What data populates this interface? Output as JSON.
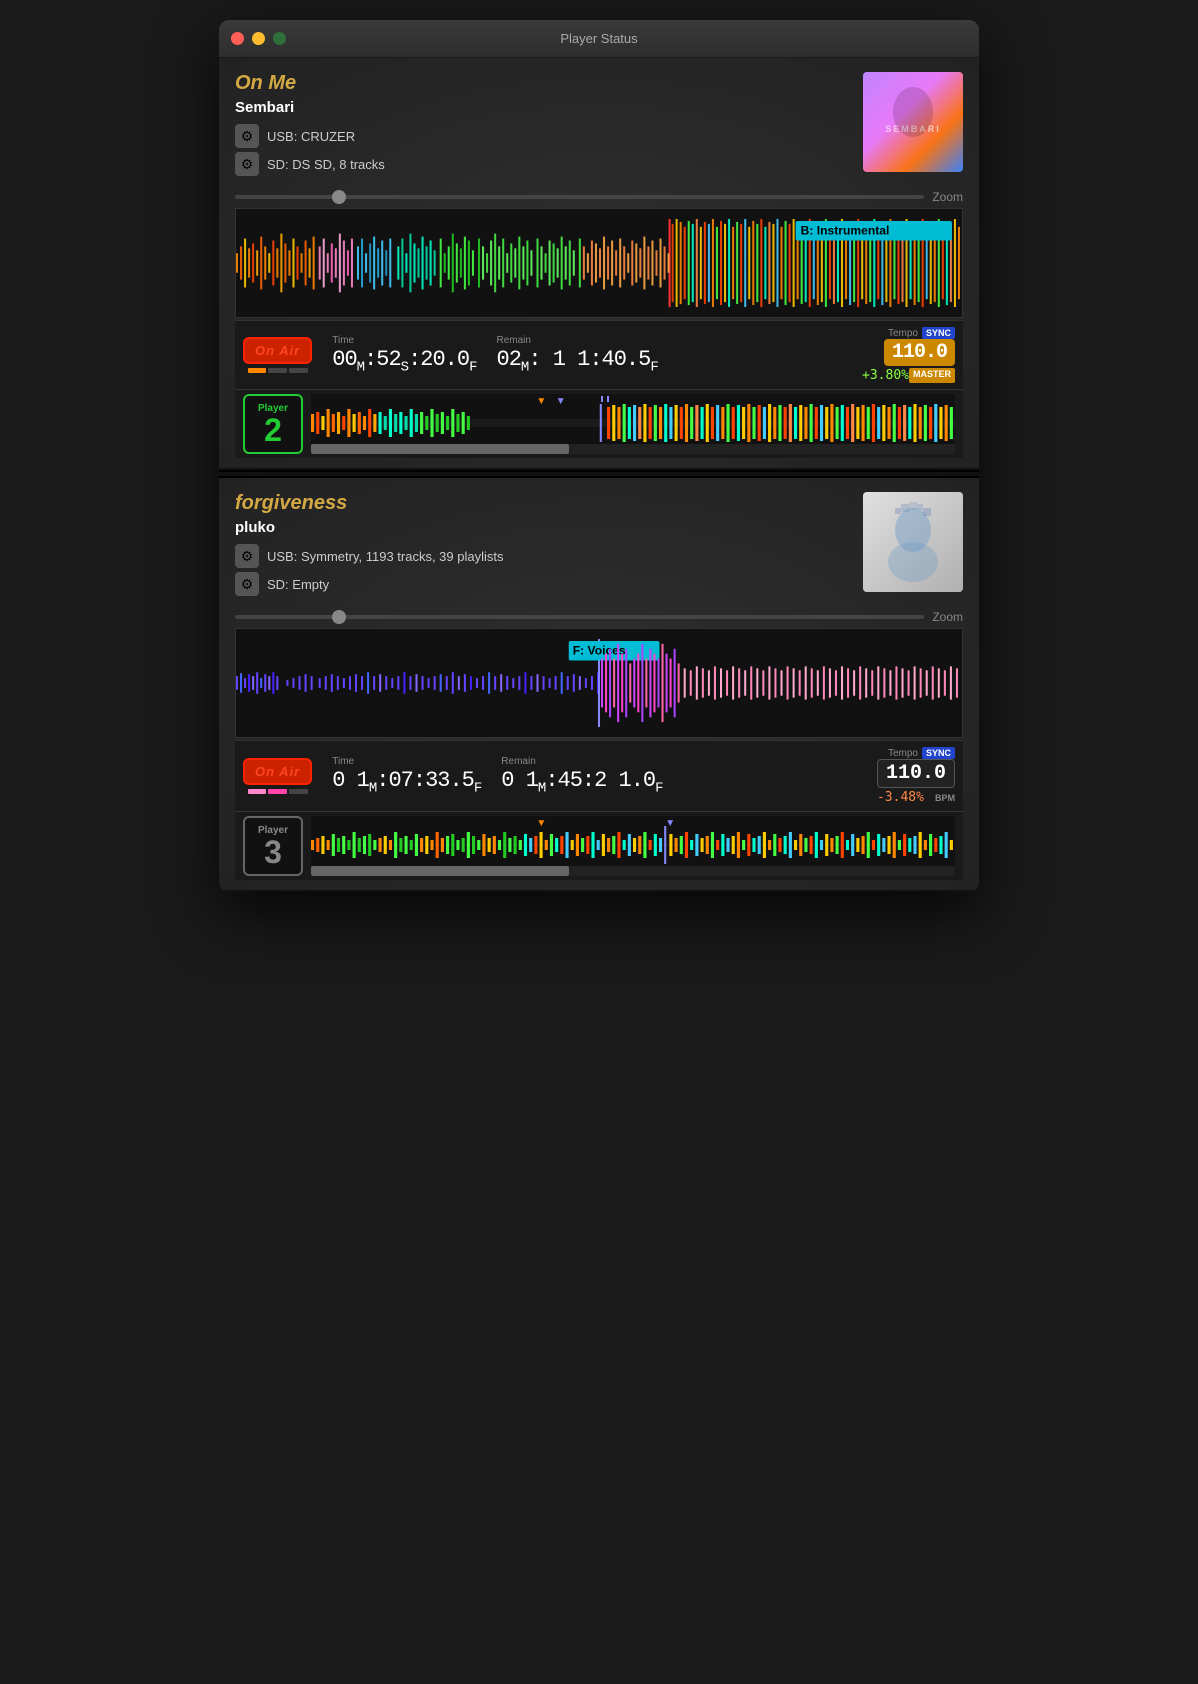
{
  "window": {
    "title": "Player Status"
  },
  "player1": {
    "track_title": "On Me",
    "artist": "Sembari",
    "source_usb": "USB: CRUZER",
    "source_sd": "SD: DS SD, 8 tracks",
    "zoom_label": "Zoom",
    "cue_label": "B: Instrumental",
    "time_label": "Time",
    "time_value": "00:52:20.0",
    "remain_label": "Remain",
    "remain_value": "02: 11:40.5",
    "tempo_label": "Tempo",
    "sync_label": "SYNC",
    "master_label": "MASTER",
    "bpm": "110.0",
    "pitch": "+3.80%",
    "on_air": "On Air",
    "player_num": "2",
    "player_label": "Player"
  },
  "player2": {
    "track_title": "forgiveness",
    "artist": "pluko",
    "source_usb": "USB: Symmetry, 1193 tracks, 39 playlists",
    "source_sd": "SD: Empty",
    "zoom_label": "Zoom",
    "cue_label": "F: Voices",
    "time_label": "Time",
    "time_value": "01:07:33.5",
    "remain_label": "Remain",
    "remain_value": "01:45:21.0",
    "tempo_label": "Tempo",
    "sync_label": "SYNC",
    "bpm_label": "BPM",
    "bpm": "110.0",
    "pitch": "-3.48%",
    "on_air": "On Air",
    "player_num": "3",
    "player_label": "Player"
  },
  "icons": {
    "gear": "⚙",
    "gear_inactive": "⚙"
  }
}
